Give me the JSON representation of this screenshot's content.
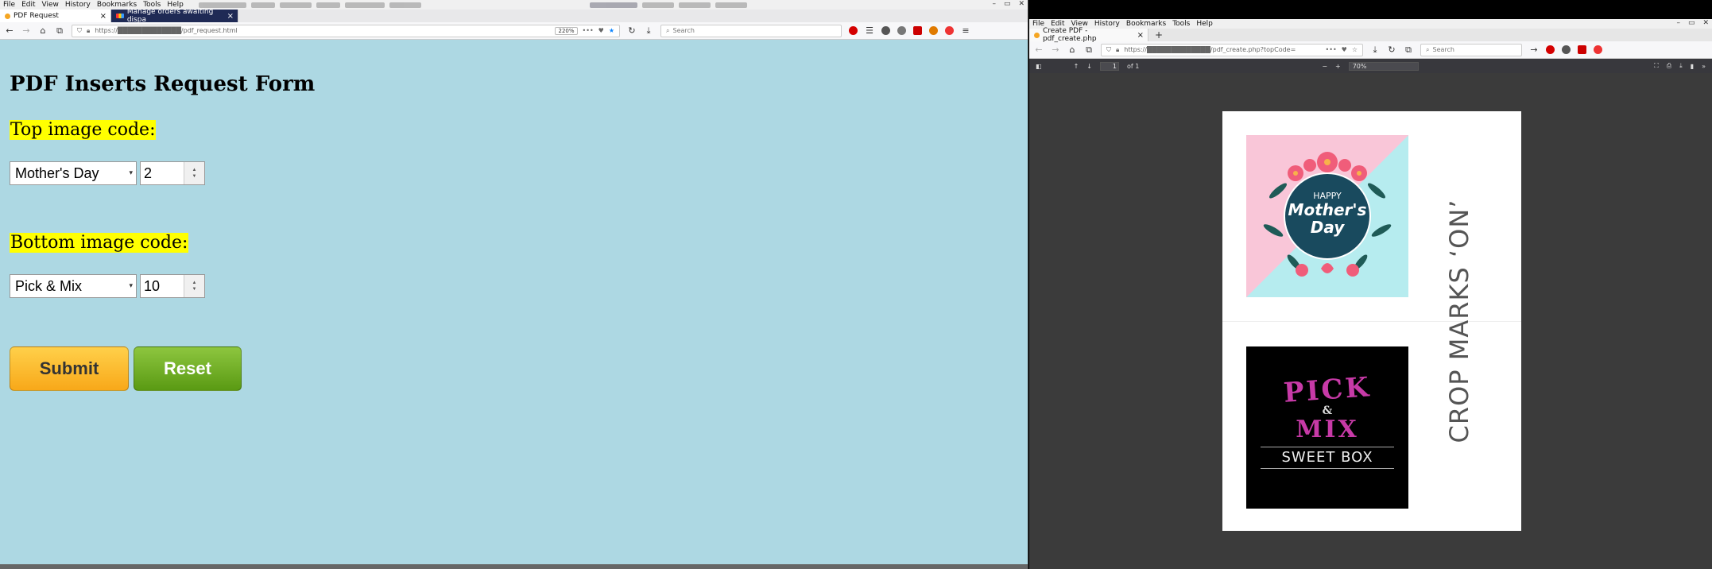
{
  "left_window": {
    "menu": [
      "File",
      "Edit",
      "View",
      "History",
      "Bookmarks",
      "Tools",
      "Help"
    ],
    "tabs": [
      {
        "label": "PDF Request",
        "close": "×"
      },
      {
        "label": "Manage orders awaiting dispa",
        "close": "×"
      }
    ],
    "url": "https://█████████████/pdf_request.html",
    "zoom": "220%",
    "search_placeholder": "Search",
    "page": {
      "title": "PDF Inserts Request Form",
      "top_label": "Top image code:",
      "top_select": "Mother's Day",
      "top_number": "2",
      "bottom_label": "Bottom image code:",
      "bottom_select": "Pick & Mix",
      "bottom_number": "10",
      "submit_label": "Submit",
      "reset_label": "Reset"
    }
  },
  "right_window": {
    "menu": [
      "File",
      "Edit",
      "View",
      "History",
      "Bookmarks",
      "Tools",
      "Help"
    ],
    "tab": {
      "label": "Create PDF - pdf_create.php",
      "close": "×",
      "new": "+"
    },
    "url": "https://█████████████/pdf_create.php?topCode=",
    "search_placeholder": "Search",
    "pdf": {
      "page_num": "1",
      "page_of": "of 1",
      "zoom": "70%",
      "top_image": {
        "line1": "HAPPY",
        "line2": "Mother's",
        "line3": "Day"
      },
      "bottom_image": {
        "line1": "PICK",
        "line2": "&",
        "line3": "MIX",
        "line4": "SWEET BOX"
      },
      "crop_text": "CROP MARKS ‘ON’"
    }
  },
  "colors": {
    "page_bg": "#add8e3",
    "highlight": "#ffff00",
    "submit": "#f8a819",
    "reset": "#5a9a13"
  }
}
